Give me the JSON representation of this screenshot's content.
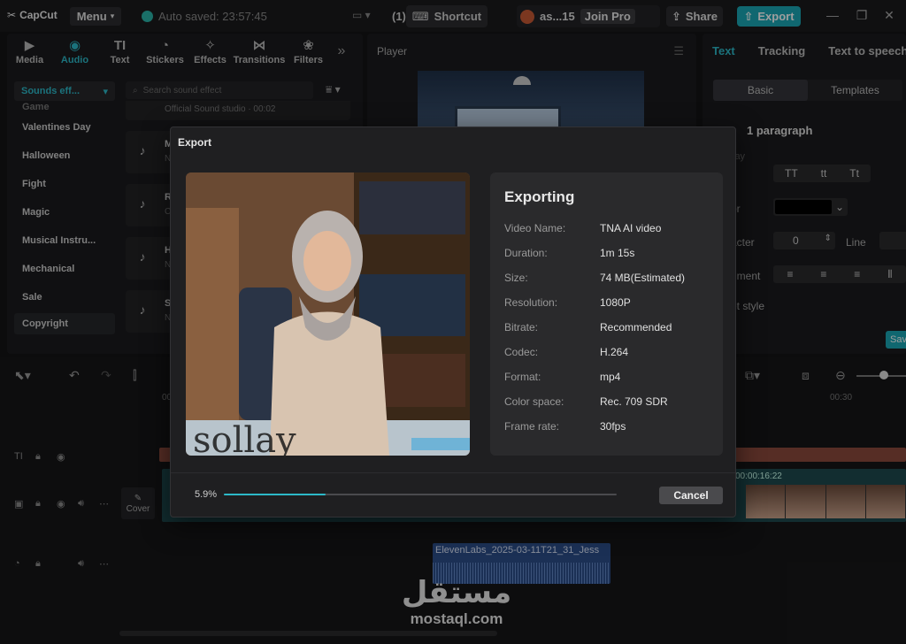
{
  "app": {
    "logo": "CapCut",
    "menu_label": "Menu",
    "autosave": "Auto saved: 23:57:45",
    "layout_count": "(1)",
    "shortcut_label": "Shortcut",
    "username": "as...15",
    "join_pro": "Join Pro",
    "share_label": "Share",
    "export_label": "Export"
  },
  "media_tabs": [
    {
      "label": "Media",
      "icon": "media-icon"
    },
    {
      "label": "Audio",
      "icon": "audio-icon",
      "active": true
    },
    {
      "label": "Text",
      "icon": "text-icon"
    },
    {
      "label": "Stickers",
      "icon": "stickers-icon"
    },
    {
      "label": "Effects",
      "icon": "effects-icon"
    },
    {
      "label": "Transitions",
      "icon": "transitions-icon"
    },
    {
      "label": "Filters",
      "icon": "filters-icon"
    }
  ],
  "audio_panel": {
    "active_category": "Sounds eff...",
    "categories": [
      "Game",
      "Valentines Day",
      "Halloween",
      "Fight",
      "Magic",
      "Musical Instru...",
      "Mechanical",
      "Sale",
      "Copyright"
    ],
    "search_placeholder": "Search sound effect",
    "partial_sound_text": "Official Sound studio · 00:02",
    "sound_initials": [
      "M",
      "R",
      "H",
      "S"
    ],
    "sound_sub_initials": [
      "N",
      "C",
      "N",
      "N"
    ]
  },
  "player": {
    "title": "Player"
  },
  "inspector": {
    "tabs": [
      "Text",
      "Tracking",
      "Text to speech"
    ],
    "segments": [
      "Basic",
      "Templates"
    ],
    "paragraph_label": "1 paragraph",
    "case_buttons": [
      "TT",
      "tt",
      "Tt"
    ],
    "character_label": "acter",
    "character_value": "0",
    "line_label": "Line",
    "alignment_label": "nment",
    "preset_label": "et style",
    "save_label": "Sav",
    "day_label": "lay",
    "color_label": "or"
  },
  "timeline": {
    "ruler_labels": [
      "00:00",
      "00:30"
    ],
    "video_timecode": "00:00:16:22",
    "cover_label": "Cover",
    "audio_clip_name": "ElevenLabs_2025-03-11T21_31_Jess"
  },
  "export_dialog": {
    "title": "Export",
    "heading": "Exporting",
    "preview_text": "sollay",
    "rows": [
      {
        "key": "Video Name:",
        "value": "TNA AI video"
      },
      {
        "key": "Duration:",
        "value": "1m 15s"
      },
      {
        "key": "Size:",
        "value": "74 MB(Estimated)"
      },
      {
        "key": "Resolution:",
        "value": "1080P"
      },
      {
        "key": "Bitrate:",
        "value": "Recommended"
      },
      {
        "key": "Codec:",
        "value": "H.264"
      },
      {
        "key": "Format:",
        "value": "mp4"
      },
      {
        "key": "Color space:",
        "value": "Rec. 709 SDR"
      },
      {
        "key": "Frame rate:",
        "value": "30fps"
      }
    ],
    "progress_label": "5.9%",
    "progress_fraction": 0.059,
    "cancel_label": "Cancel"
  },
  "watermark": {
    "arabic": "مستقل",
    "latin": "mostaql.com"
  },
  "colors": {
    "accent": "#2cb9c8",
    "export_button": "#1aa7b5",
    "dialog_bg": "#1f1f21"
  }
}
